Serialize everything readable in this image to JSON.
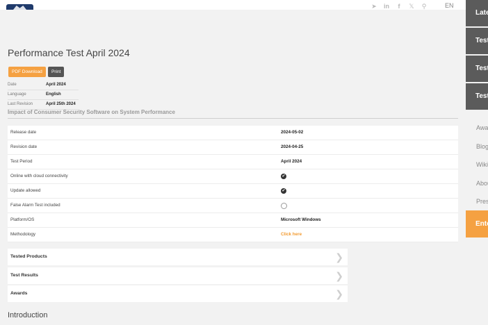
{
  "header": {
    "language": "EN",
    "icons": [
      "telegram-icon",
      "linkedin-icon",
      "facebook-icon",
      "x-icon",
      "search-icon"
    ]
  },
  "page": {
    "title": "Performance Test April 2024",
    "pdf_label": "PDF Download",
    "print_label": "Print",
    "meta": [
      {
        "key": "Date",
        "value": "April 2024"
      },
      {
        "key": "Language",
        "value": "English"
      },
      {
        "key": "Last Revision",
        "value": "April 25th 2024"
      }
    ],
    "subtitle": "Impact of Consumer Security Software on System Performance",
    "details": [
      {
        "key": "Release date",
        "value": "2024-05-02",
        "type": "text"
      },
      {
        "key": "Revision date",
        "value": "2024-04-25",
        "type": "text"
      },
      {
        "key": "Test Period",
        "value": "April 2024",
        "type": "text"
      },
      {
        "key": "Online with cloud connectivity",
        "value": "",
        "type": "check"
      },
      {
        "key": "Update allowed",
        "value": "",
        "type": "check"
      },
      {
        "key": "False Alarm Test included",
        "value": "",
        "type": "empty"
      },
      {
        "key": "Platform/OS",
        "value": "Microsoft Windows",
        "type": "text"
      },
      {
        "key": "Methodology",
        "value": "Click here",
        "type": "link"
      }
    ],
    "sections": [
      "Tested Products",
      "Test Results",
      "Awards"
    ],
    "intro_heading": "Introduction"
  },
  "sidebar": {
    "dark_items": [
      "Latest",
      "Test",
      "Test",
      "Test"
    ],
    "light_items": [
      "Awards",
      "Blog",
      "Wiki",
      "About",
      "Press"
    ],
    "cta": "Enterprise"
  },
  "colors": {
    "accent": "#f5a142",
    "dark": "#5b5b5b",
    "brand": "#1f3a6b"
  }
}
